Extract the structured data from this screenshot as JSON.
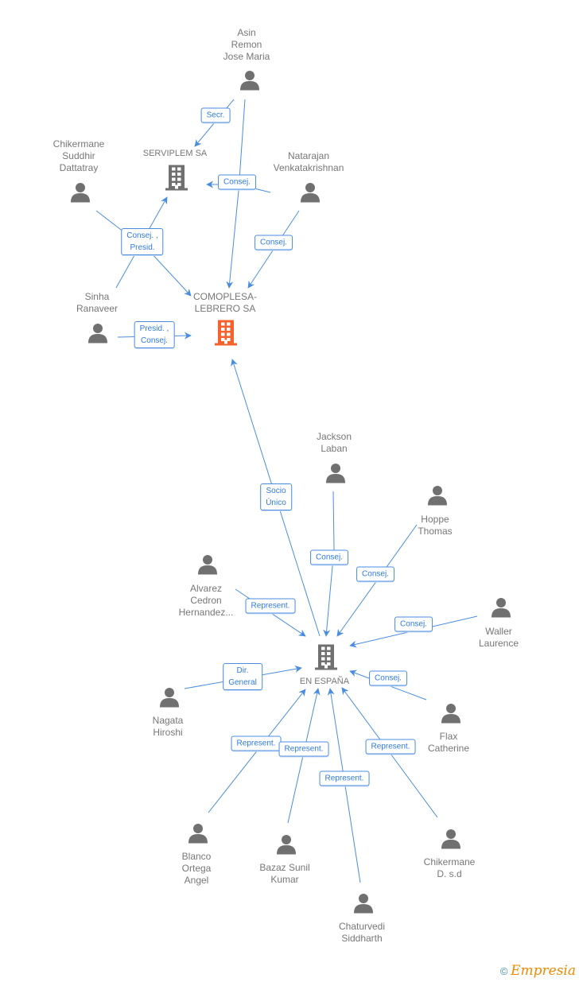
{
  "colors": {
    "edge": "#4a8de0",
    "person": "#707070",
    "company": "#707070",
    "focus_company": "#f5622d"
  },
  "companies": [
    {
      "name": "SERVIPLEM SA",
      "icon": "building-icon"
    },
    {
      "name": "COMOPLESA-LEBRERO SA",
      "lines": [
        "COMOPLESA-",
        "LEBRERO SA"
      ],
      "icon": "building-icon",
      "focus": true
    },
    {
      "name": "EN ESPAÑA",
      "icon": "building-icon"
    }
  ],
  "persons": [
    {
      "lines": [
        "Asin",
        "Remon",
        "Jose Maria"
      ]
    },
    {
      "lines": [
        "Chikermane",
        "Suddhir",
        "Dattatray"
      ]
    },
    {
      "lines": [
        "Natarajan",
        "Venkatakrishnan"
      ]
    },
    {
      "lines": [
        "Sinha",
        "Ranaveer"
      ]
    },
    {
      "lines": [
        "Jackson",
        "Laban"
      ]
    },
    {
      "lines": [
        "Hoppe",
        "Thomas"
      ]
    },
    {
      "lines": [
        "Alvarez",
        "Cedron",
        "Hernandez..."
      ]
    },
    {
      "lines": [
        "Waller",
        "Laurence"
      ]
    },
    {
      "lines": [
        "Nagata",
        "Hiroshi"
      ]
    },
    {
      "lines": [
        "Flax",
        "Catherine"
      ]
    },
    {
      "lines": [
        "Blanco",
        "Ortega",
        "Angel"
      ]
    },
    {
      "lines": [
        "Bazaz Sunil",
        "Kumar"
      ]
    },
    {
      "lines": [
        "Chikermane",
        "D. s.d"
      ]
    },
    {
      "lines": [
        "Chaturvedi",
        "Siddharth"
      ]
    }
  ],
  "relations": [
    {
      "lines": [
        "Secr."
      ]
    },
    {
      "lines": [
        "Consej."
      ]
    },
    {
      "lines": [
        "Consej. ,",
        "Presid."
      ]
    },
    {
      "lines": [
        "Consej."
      ]
    },
    {
      "lines": [
        "Presid. ,",
        "Consej."
      ]
    },
    {
      "lines": [
        "Socio",
        "Único"
      ]
    },
    {
      "lines": [
        "Consej."
      ]
    },
    {
      "lines": [
        "Consej."
      ]
    },
    {
      "lines": [
        "Represent."
      ]
    },
    {
      "lines": [
        "Consej."
      ]
    },
    {
      "lines": [
        "Dir.",
        "General"
      ]
    },
    {
      "lines": [
        "Consej."
      ]
    },
    {
      "lines": [
        "Represent."
      ]
    },
    {
      "lines": [
        "Represent."
      ]
    },
    {
      "lines": [
        "Represent."
      ]
    },
    {
      "lines": [
        "Represent."
      ]
    }
  ],
  "footer": {
    "copyright": "©",
    "brand": "Empresia"
  }
}
